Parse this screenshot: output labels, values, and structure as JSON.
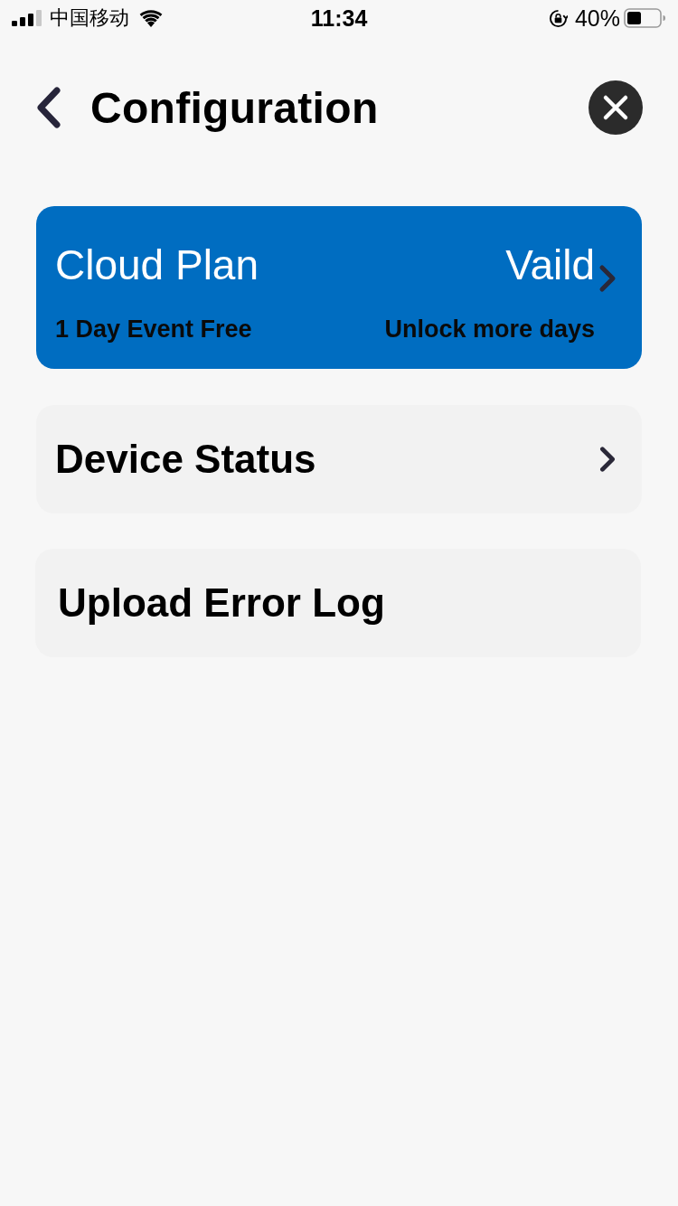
{
  "status_bar": {
    "carrier": "中国移动",
    "time": "11:34",
    "battery": "40%"
  },
  "header": {
    "title": "Configuration"
  },
  "plan_card": {
    "title": "Cloud Plan",
    "status": "Vaild",
    "subtitle": "1 Day Event Free",
    "action": "Unlock more days"
  },
  "menu_items": [
    {
      "label": "Device Status",
      "chevron": true
    },
    {
      "label": "Upload Error Log",
      "chevron": false
    }
  ]
}
